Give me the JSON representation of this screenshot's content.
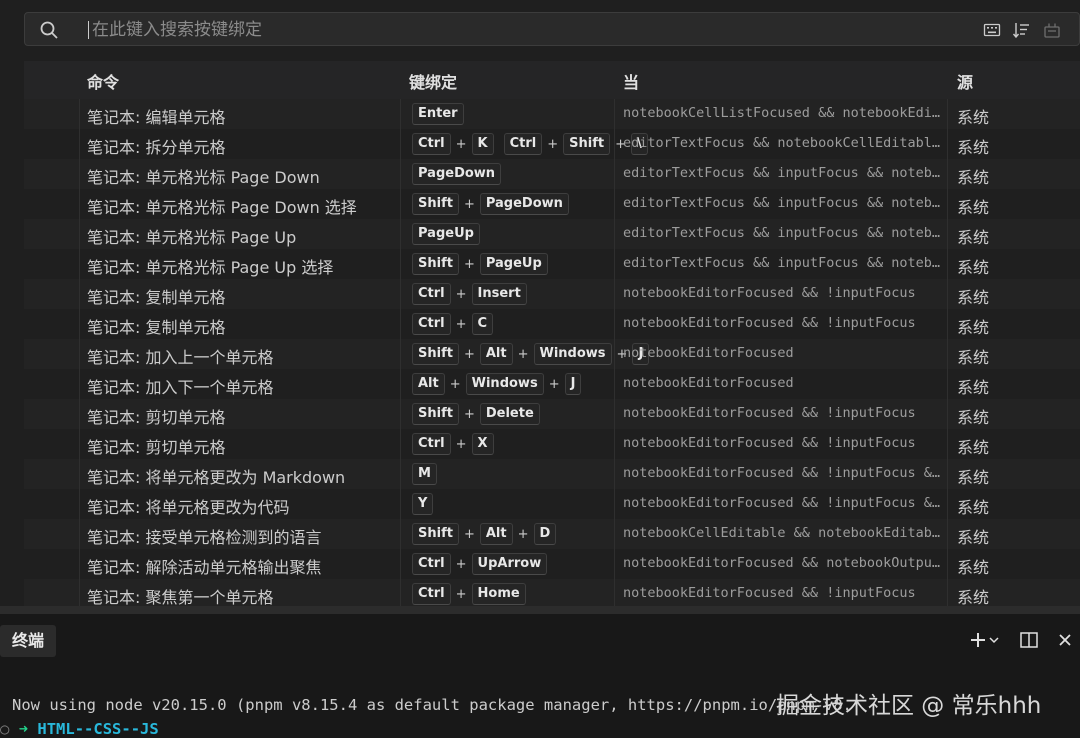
{
  "search": {
    "placeholder": "在此键入搜索按键绑定"
  },
  "toolbar_icons": [
    "keyboard-icon",
    "sort-precedence-icon",
    "clear-icon"
  ],
  "table": {
    "headers": {
      "command": "命令",
      "keybinding": "键绑定",
      "when": "当",
      "source": "源"
    },
    "rows": [
      {
        "command": "笔记本: 编辑单元格",
        "keys": [
          [
            "Enter"
          ]
        ],
        "when": "notebookCellListFocused && notebookEdi…",
        "source": "系统"
      },
      {
        "command": "笔记本: 拆分单元格",
        "keys": [
          [
            "Ctrl",
            "K"
          ],
          [
            "Ctrl",
            "Shift",
            "\\"
          ]
        ],
        "when": "editorTextFocus && notebookCellEditabl…",
        "source": "系统"
      },
      {
        "command": "笔记本: 单元格光标 Page Down",
        "keys": [
          [
            "PageDown"
          ]
        ],
        "when": "editorTextFocus && inputFocus && noteb…",
        "source": "系统"
      },
      {
        "command": "笔记本: 单元格光标 Page Down 选择",
        "keys": [
          [
            "Shift",
            "PageDown"
          ]
        ],
        "when": "editorTextFocus && inputFocus && noteb…",
        "source": "系统"
      },
      {
        "command": "笔记本: 单元格光标 Page Up",
        "keys": [
          [
            "PageUp"
          ]
        ],
        "when": "editorTextFocus && inputFocus && noteb…",
        "source": "系统"
      },
      {
        "command": "笔记本: 单元格光标 Page Up 选择",
        "keys": [
          [
            "Shift",
            "PageUp"
          ]
        ],
        "when": "editorTextFocus && inputFocus && noteb…",
        "source": "系统"
      },
      {
        "command": "笔记本: 复制单元格",
        "keys": [
          [
            "Ctrl",
            "Insert"
          ]
        ],
        "when": "notebookEditorFocused && !inputFocus",
        "source": "系统"
      },
      {
        "command": "笔记本: 复制单元格",
        "keys": [
          [
            "Ctrl",
            "C"
          ]
        ],
        "when": "notebookEditorFocused && !inputFocus",
        "source": "系统"
      },
      {
        "command": "笔记本: 加入上一个单元格",
        "keys": [
          [
            "Shift",
            "Alt",
            "Windows",
            "J"
          ]
        ],
        "when": "notebookEditorFocused",
        "source": "系统"
      },
      {
        "command": "笔记本: 加入下一个单元格",
        "keys": [
          [
            "Alt",
            "Windows",
            "J"
          ]
        ],
        "when": "notebookEditorFocused",
        "source": "系统"
      },
      {
        "command": "笔记本: 剪切单元格",
        "keys": [
          [
            "Shift",
            "Delete"
          ]
        ],
        "when": "notebookEditorFocused && !inputFocus",
        "source": "系统"
      },
      {
        "command": "笔记本: 剪切单元格",
        "keys": [
          [
            "Ctrl",
            "X"
          ]
        ],
        "when": "notebookEditorFocused && !inputFocus",
        "source": "系统"
      },
      {
        "command": "笔记本: 将单元格更改为 Markdown",
        "keys": [
          [
            "M"
          ]
        ],
        "when": "notebookEditorFocused && !inputFocus &…",
        "source": "系统"
      },
      {
        "command": "笔记本: 将单元格更改为代码",
        "keys": [
          [
            "Y"
          ]
        ],
        "when": "notebookEditorFocused && !inputFocus &…",
        "source": "系统"
      },
      {
        "command": "笔记本: 接受单元格检测到的语言",
        "keys": [
          [
            "Shift",
            "Alt",
            "D"
          ]
        ],
        "when": "notebookCellEditable && notebookEditab…",
        "source": "系统"
      },
      {
        "command": "笔记本: 解除活动单元格输出聚焦",
        "keys": [
          [
            "Ctrl",
            "UpArrow"
          ]
        ],
        "when": "notebookEditorFocused && notebookOutpu…",
        "source": "系统"
      },
      {
        "command": "笔记本: 聚焦第一个单元格",
        "keys": [
          [
            "Ctrl",
            "Home"
          ]
        ],
        "when": "notebookEditorFocused && !inputFocus",
        "source": "系统"
      }
    ]
  },
  "panel": {
    "tab_label": "终端",
    "icons": [
      "add-terminal-icon",
      "chevron-down-icon",
      "split-panel-icon",
      "close-icon"
    ]
  },
  "terminal": {
    "line1": "Now using node v20.15.0 (pnpm v8.15.4 as default package manager, https://pnpm.io/pnpm-v8.",
    "prompt_arrow": "➜",
    "prompt_dir": "HTML--CSS--JS",
    "colors": {
      "arrow": "#23d18b",
      "dir": "#29b8db"
    }
  },
  "watermark": "掘金技术社区 @ 常乐hhh",
  "colors": {
    "background": "#1f1f1f",
    "header": "#252526",
    "text": "#cccccc",
    "muted": "#9d9d9d"
  }
}
